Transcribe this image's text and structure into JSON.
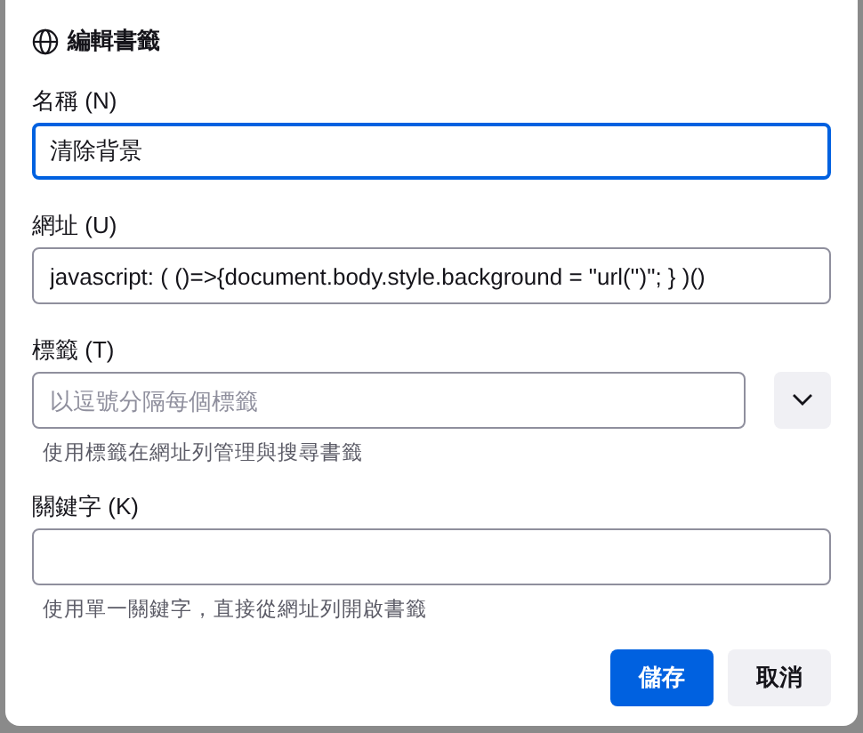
{
  "dialog": {
    "title": "編輯書籤"
  },
  "fields": [
    {
      "kind": "text",
      "label": "名稱 (N)",
      "value": "清除背景",
      "focused": true
    },
    {
      "kind": "text",
      "label": "網址 (U)",
      "value": "javascript: ( ()=>{document.body.style.background = \"url('')\"; } )()",
      "focused": false
    },
    {
      "kind": "tags",
      "label": "標籤 (T)",
      "placeholder": "以逗號分隔每個標籤",
      "hint": "使用標籤在網址列管理與搜尋書籤",
      "focused": false
    },
    {
      "kind": "text",
      "label": "關鍵字 (K)",
      "hint": "使用單一關鍵字，直接從網址列開啟書籤",
      "focused": false
    }
  ],
  "buttons": [
    {
      "label": "儲存",
      "kind": "primary"
    },
    {
      "label": "取消",
      "kind": "secondary"
    }
  ]
}
